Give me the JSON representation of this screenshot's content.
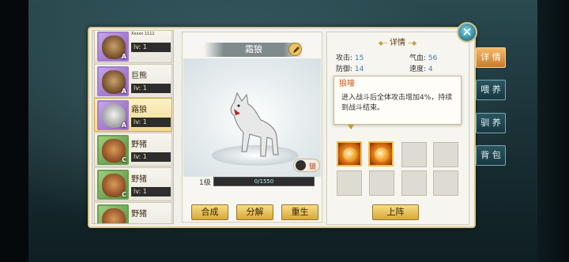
{
  "pet_list": [
    {
      "name": "",
      "tiny_name": "Xxxxx 1111",
      "level": "lv: 1",
      "grade": "A",
      "frame": "purple",
      "face": "bear"
    },
    {
      "name": "巨熊",
      "level": "lv: 1",
      "grade": "A",
      "frame": "purple",
      "face": "bear"
    },
    {
      "name": "霜狼",
      "level": "lv: 1",
      "grade": "A",
      "frame": "purple",
      "face": "wolf",
      "selected": true
    },
    {
      "name": "野猪",
      "level": "lv: 1",
      "grade": "C",
      "frame": "green",
      "face": "boar"
    },
    {
      "name": "野猪",
      "level": "lv: 1",
      "grade": "C",
      "frame": "green",
      "face": "boar"
    },
    {
      "name": "野猪",
      "level": "",
      "grade": "",
      "frame": "green",
      "face": "boar"
    }
  ],
  "pet_view": {
    "name": "霜狼",
    "lock_label": "锁",
    "level_label": "1级",
    "exp_text": "0/1550",
    "exp_fraction": 0.0
  },
  "actions": {
    "merge": "合成",
    "decompose": "分解",
    "rebirth": "重生",
    "deploy": "上阵"
  },
  "detail": {
    "title": "详情",
    "attack_label": "攻击:",
    "attack_value": "15",
    "hp_label": "气血:",
    "hp_value": "56",
    "defense_label": "防御:",
    "defense_value": "14",
    "speed_label": "速度:",
    "speed_value": "4"
  },
  "tooltip": {
    "title": "狼嚎",
    "text": "进入战斗后全体攻击增加4%，持续到战斗结束。"
  },
  "skills": [
    {
      "filled": true
    },
    {
      "filled": true
    },
    {
      "filled": false
    },
    {
      "filled": false
    },
    {
      "filled": false
    },
    {
      "filled": false
    },
    {
      "filled": false
    },
    {
      "filled": false
    }
  ],
  "side_tabs": [
    {
      "label": "详 情",
      "active": true
    },
    {
      "label": "喂 养",
      "active": false
    },
    {
      "label": "驯 养",
      "active": false
    },
    {
      "label": "背 包",
      "active": false
    }
  ],
  "colors": {
    "frame_gold": "#d9c68c",
    "tab_active": "#e0953f",
    "stat_value": "#3f7bb5",
    "tooltip_title": "#cf5a1b"
  }
}
